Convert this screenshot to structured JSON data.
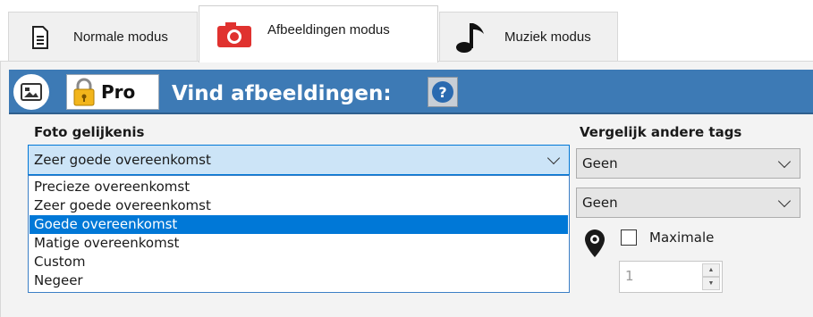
{
  "tabs": [
    {
      "label": "Normale modus",
      "icon": "document-icon",
      "active": false
    },
    {
      "label": "Afbeeldingen modus",
      "icon": "camera-icon",
      "active": true
    },
    {
      "label": "Muziek modus",
      "icon": "music-note-icon",
      "active": false
    }
  ],
  "header": {
    "pro_label": "Pro",
    "title": "Vind afbeeldingen:",
    "help": "?"
  },
  "photo_similarity": {
    "label": "Foto gelijkenis",
    "selected": "Zeer goede overeenkomst",
    "options": [
      "Precieze overeenkomst",
      "Zeer goede overeenkomst",
      "Goede overeenkomst",
      "Matige overeenkomst",
      "Custom",
      "Negeer"
    ],
    "highlighted_index": 2
  },
  "compare_tags": {
    "label": "Vergelijk andere tags",
    "combo1": "Geen",
    "combo2": "Geen"
  },
  "location": {
    "checkbox_label": "Maximale",
    "checked": false,
    "spin_value": "1"
  },
  "colors": {
    "header_blue": "#3d7ab5",
    "selection_blue": "#0078d7",
    "camera_red": "#e0322f"
  }
}
